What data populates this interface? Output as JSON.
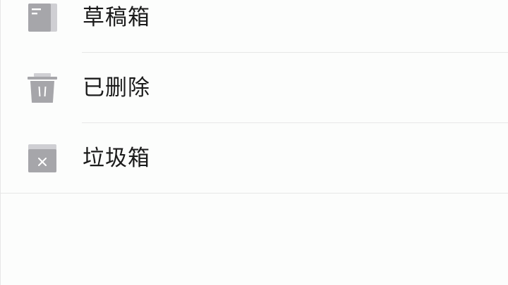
{
  "folders": [
    {
      "label": "草稿箱",
      "icon": "draft-icon"
    },
    {
      "label": "已删除",
      "icon": "trash-icon"
    },
    {
      "label": "垃圾箱",
      "icon": "spam-icon"
    }
  ],
  "colors": {
    "icon_gray": "#a6a6aa",
    "icon_light": "#cfcfd3",
    "text": "#1b1b1b",
    "divider": "#e7e7e7",
    "background": "#fcfdfc"
  }
}
